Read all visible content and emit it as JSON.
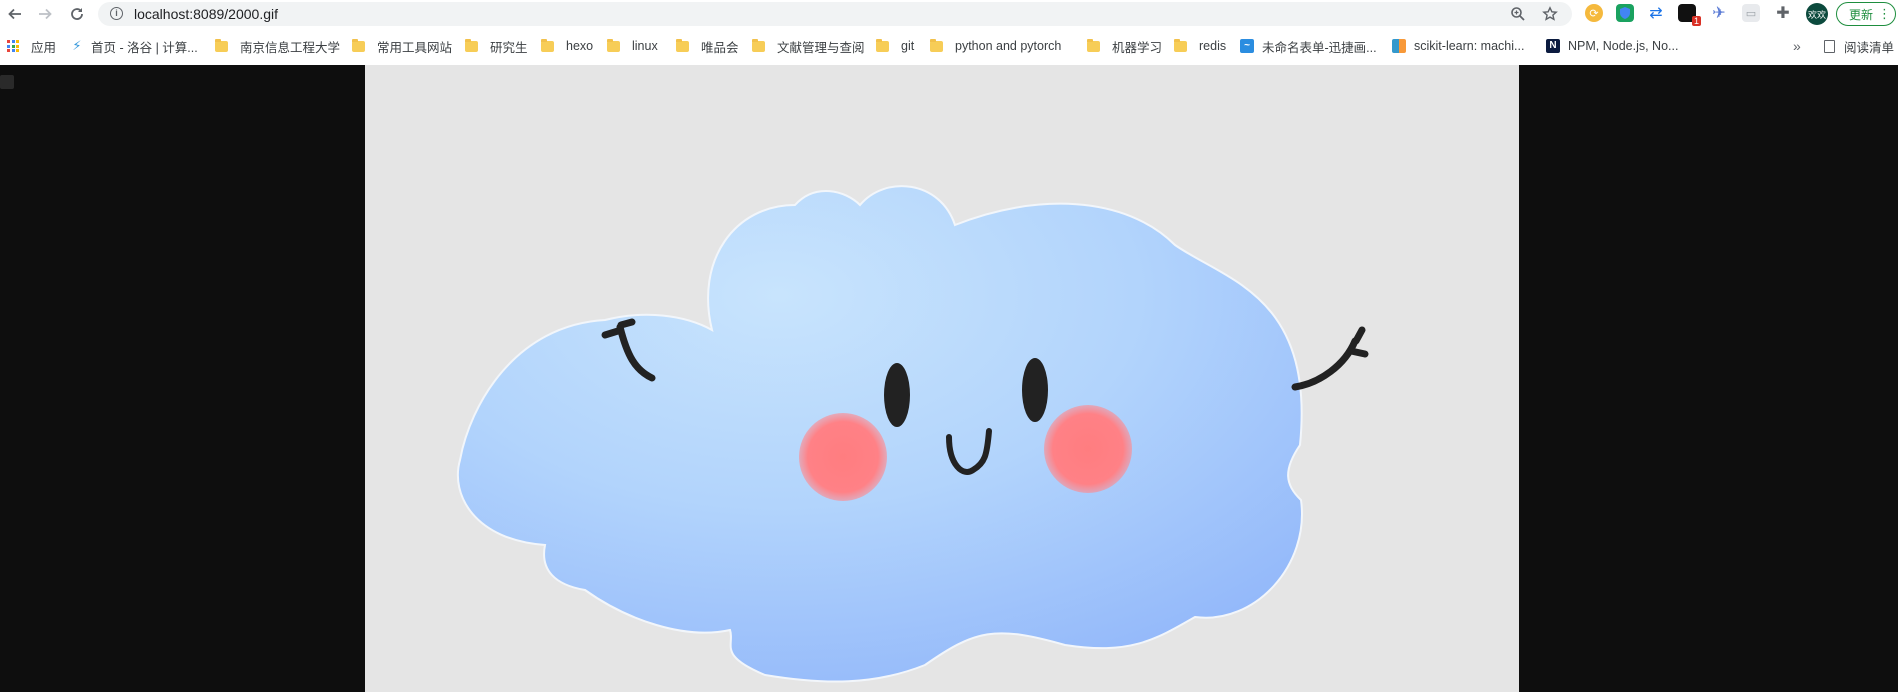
{
  "browser": {
    "url": "localhost:8089/2000.gif",
    "avatar_label": "欢欢",
    "update_label": "更新",
    "extension_badge": "1",
    "nav": {
      "back": "back-icon",
      "forward": "forward-icon",
      "reload": "reload-icon"
    }
  },
  "bookmarks": {
    "apps_label": "应用",
    "items": [
      {
        "label": "首页 - 洛谷 | 计算...",
        "icon": "luogu-favicon"
      },
      {
        "label": "南京信息工程大学",
        "icon": "folder-icon"
      },
      {
        "label": "常用工具网站",
        "icon": "folder-icon"
      },
      {
        "label": "研究生",
        "icon": "folder-icon"
      },
      {
        "label": "hexo",
        "icon": "folder-icon"
      },
      {
        "label": "linux",
        "icon": "folder-icon"
      },
      {
        "label": "唯品会",
        "icon": "folder-icon"
      },
      {
        "label": "文献管理与查阅",
        "icon": "folder-icon"
      },
      {
        "label": "git",
        "icon": "folder-icon"
      },
      {
        "label": "python and pytorch",
        "icon": "folder-icon"
      },
      {
        "label": "机器学习",
        "icon": "folder-icon"
      },
      {
        "label": "redis",
        "icon": "folder-icon"
      },
      {
        "label": "未命名表单-迅捷画...",
        "icon": "xunjie-favicon"
      },
      {
        "label": "scikit-learn: machi...",
        "icon": "sklearn-favicon"
      },
      {
        "label": "NPM, Node.js, No...",
        "icon": "n-favicon"
      }
    ],
    "overflow": "»",
    "reading_list_label": "阅读清单"
  },
  "image": {
    "description_icon": "smiling-cloud-image",
    "background": "#e5e5e5",
    "cloud_color": "#a9ccfb",
    "cheek_color": "#ff7f82"
  }
}
